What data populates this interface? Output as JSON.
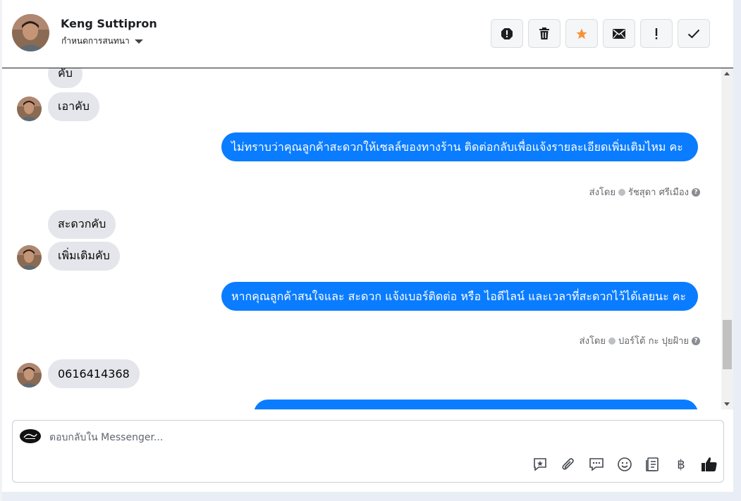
{
  "header": {
    "contact_name": "Keng Suttipron",
    "assign_label": "กำหนดการสนทนา"
  },
  "toolbar": {
    "buttons": [
      {
        "icon": "spam-icon"
      },
      {
        "icon": "trash-icon"
      },
      {
        "icon": "star-icon",
        "color": "#f7923a"
      },
      {
        "icon": "mail-icon"
      },
      {
        "icon": "important-icon"
      },
      {
        "icon": "done-check-icon"
      }
    ]
  },
  "messages": {
    "m1": "คับ",
    "m2": "เอาคับ",
    "m3": "ไม่ทราบว่าคุณลูกค้าสะดวกให้เซลล์ของทางร้าน ติดต่อกลับเพื่อแจ้งรายละเอียดเพิ่มเติมไหม คะ",
    "m3_sent_prefix": "ส่งโดย",
    "m3_sender": "รัชสุดา ศรีเมือง",
    "m4": "สะดวกคับ",
    "m5": "เพิ่มเติมคับ",
    "m6": "หากคุณลูกค้าสนใจและ สะดวก แจ้งเบอร์ติดต่อ หรือ ไอดีไลน์ และเวลาที่สะดวกไว้ได้เลยนะ คะ",
    "m6_sent_prefix": "ส่งโดย",
    "m6_sender": "ปอร์โต้ กะ ปุยฝ้าย",
    "m7": "0616414368"
  },
  "composer": {
    "placeholder": "ตอบกลับใน Messenger...",
    "icons": [
      "saved-reply-icon",
      "attach-icon",
      "chat-bubble-icon",
      "emoji-icon",
      "catalog-icon",
      "baht-icon",
      "thumbs-up-icon"
    ],
    "baht_symbol": "฿"
  },
  "colors": {
    "outgoing_bubble": "#0a7cff",
    "incoming_bubble": "#e4e6eb",
    "accent_star": "#f7923a"
  }
}
